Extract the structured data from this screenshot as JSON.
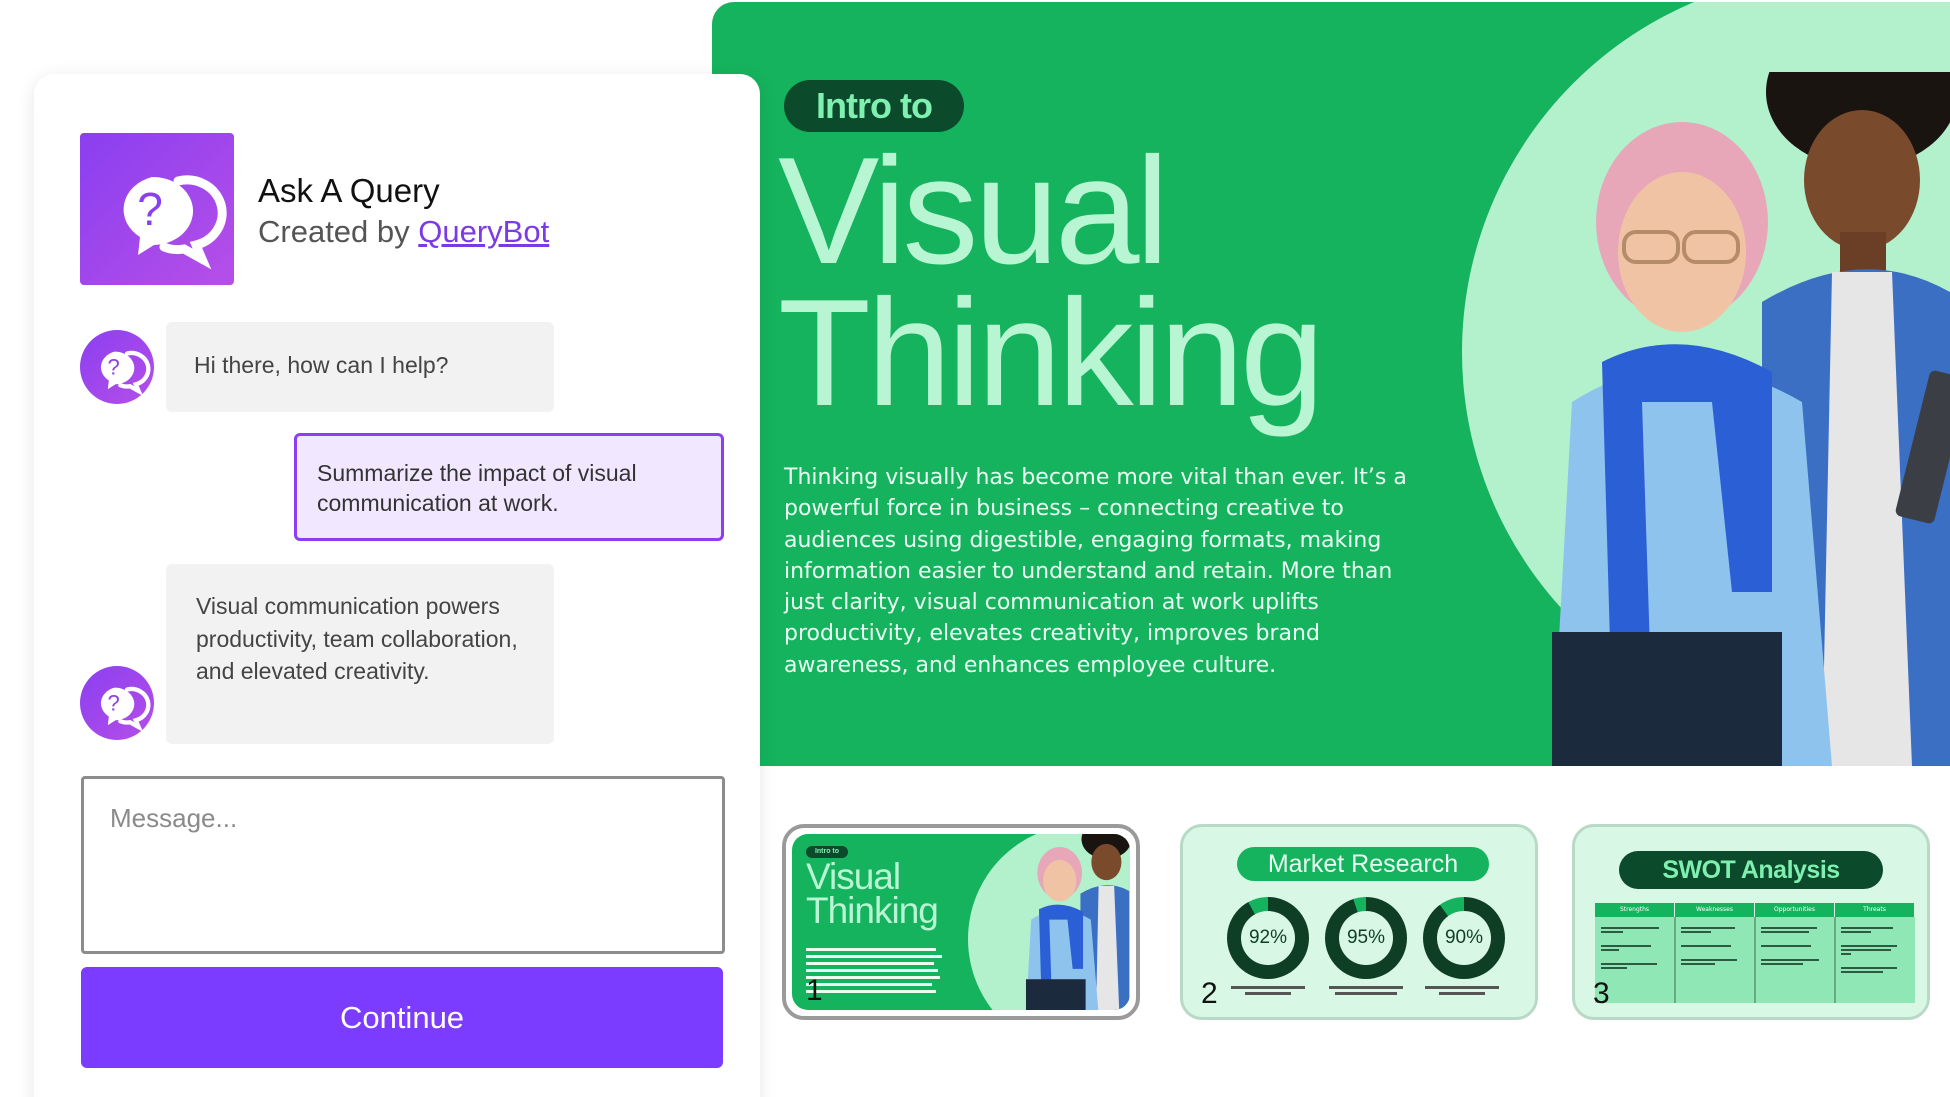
{
  "slide": {
    "pill": "Intro to",
    "title_line1": "Visual",
    "title_line2": "Thinking",
    "body": "Thinking visually has become more vital than ever. It’s a powerful force in business – connecting creative to audiences using digestible, engaging formats, making information easier to understand and retain. More than just clarity, visual communication at work uplifts productivity, elevates creativity, improves brand awareness, and enhances employee culture."
  },
  "chat": {
    "app_name": "Ask A Query",
    "created_by_prefix": "Created by",
    "creator": "QueryBot",
    "messages": [
      {
        "from": "bot",
        "text": "Hi there, how can I help?"
      },
      {
        "from": "user",
        "text": "Summarize the impact of visual communication at work."
      },
      {
        "from": "bot",
        "text": "Visual communication powers productivity, team collaboration, and elevated creativity."
      }
    ],
    "input": {
      "placeholder": "Message...",
      "value": ""
    },
    "continue_label": "Continue"
  },
  "thumbnails": [
    {
      "number": "1",
      "pill": "Intro to",
      "title_line1": "Visual",
      "title_line2": "Thinking",
      "selected": true
    },
    {
      "number": "2",
      "title": "Market Research",
      "stats": [
        {
          "value": "92%",
          "percent": 92
        },
        {
          "value": "95%",
          "percent": 95
        },
        {
          "value": "90%",
          "percent": 90
        }
      ]
    },
    {
      "number": "3",
      "title": "SWOT Analysis",
      "columns": [
        "Strengths",
        "Weaknesses",
        "Opportunities",
        "Threats"
      ]
    }
  ],
  "colors": {
    "brand_purple": "#7c3cff",
    "slide_green": "#16b35e",
    "slide_dark_green": "#0b4a2a",
    "slide_light_green": "#b3f0cc"
  },
  "icons": {
    "app_icon": "chat-question-icon",
    "bot_avatar": "chat-question-icon"
  }
}
